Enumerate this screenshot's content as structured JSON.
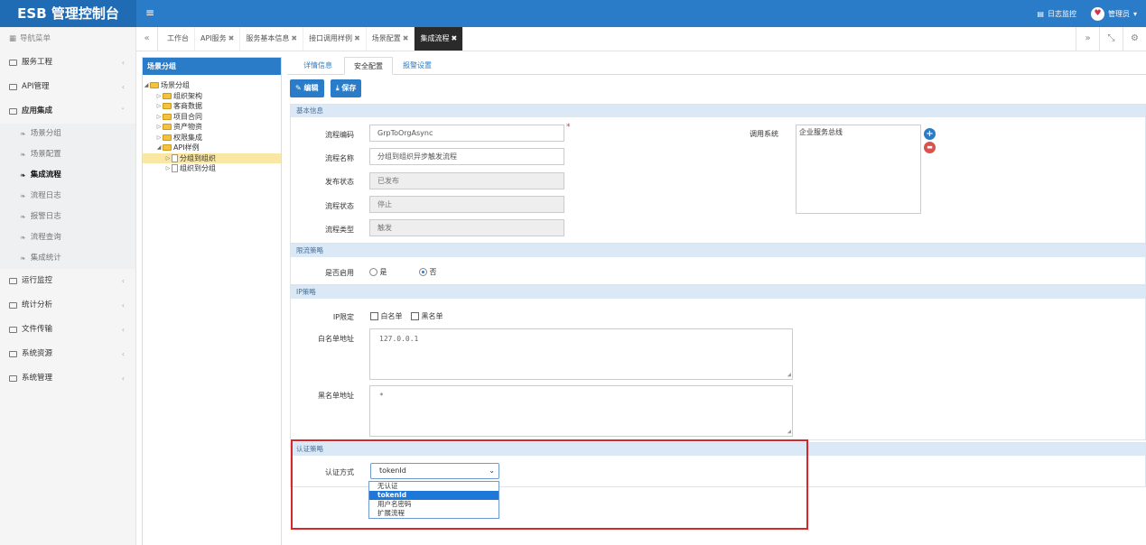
{
  "header": {
    "brand": "ESB 管理控制台",
    "menu_toggle_glyph": "≡",
    "log_monitor": "日志监控",
    "user": "管理员",
    "avatar_glyph": "♥",
    "colors": {
      "primary": "#2b7cc8",
      "brand_bg": "#1f6cb5",
      "highlight": "#d9262a"
    }
  },
  "sidebar": {
    "title": "导航菜单",
    "items": [
      {
        "label": "服务工程",
        "chevron": "‹"
      },
      {
        "label": "API管理",
        "chevron": "‹"
      },
      {
        "label": "应用集成",
        "chevron": "ˇ"
      }
    ],
    "subitems": [
      {
        "label": "场景分组"
      },
      {
        "label": "场景配置"
      },
      {
        "label": "集成流程"
      },
      {
        "label": "流程日志"
      },
      {
        "label": "报警日志"
      },
      {
        "label": "流程查询"
      },
      {
        "label": "集成统计"
      }
    ],
    "items_after": [
      {
        "label": "运行监控",
        "chevron": "‹"
      },
      {
        "label": "统计分析",
        "chevron": "‹"
      },
      {
        "label": "文件传输",
        "chevron": "‹"
      },
      {
        "label": "系统资源",
        "chevron": "‹"
      },
      {
        "label": "系统管理",
        "chevron": "‹"
      }
    ]
  },
  "tabbar": {
    "prev_glyph": "«",
    "next_glyph": "»",
    "fullscreen_glyph": "⤡",
    "settings_glyph": "⚙",
    "close_glyph": "✖",
    "tabs": [
      {
        "label": "工作台"
      },
      {
        "label": "API服务"
      },
      {
        "label": "服务基本信息"
      },
      {
        "label": "接口调用样例"
      },
      {
        "label": "场景配置"
      },
      {
        "label": "集成流程"
      }
    ]
  },
  "tree": {
    "title": "场景分组",
    "root": "场景分组",
    "nodes": [
      "组织架构",
      "客商数据",
      "项目合同",
      "资产物资",
      "权限集成",
      "API样例"
    ],
    "children": [
      "分组到组织",
      "组织到分组"
    ]
  },
  "main": {
    "subtabs": [
      "详情信息",
      "安全配置",
      "报警设置"
    ],
    "edit_button": "编辑",
    "save_button": "保存",
    "edit_icon": "✎",
    "save_icon": "⤓",
    "basic": {
      "title": "基本信息",
      "code_label": "流程编码",
      "code_value": "GrpToOrgAsync",
      "name_label": "流程名称",
      "name_value": "分组到组织异步触发流程",
      "publish_label": "发布状态",
      "publish_value": "已发布",
      "status_label": "流程状态",
      "status_value": "停止",
      "type_label": "流程类型",
      "type_value": "触发",
      "caller_label": "调用系统",
      "caller_value": "企业服务总线",
      "required_mark": "*",
      "add_glyph": "+",
      "delete_glyph": "▬"
    },
    "throttle": {
      "title": "限流策略",
      "enable_label": "是否启用",
      "opt_yes": "是",
      "opt_no": "否"
    },
    "ip": {
      "title": "IP策略",
      "limit_label": "IP限定",
      "whitelist": "白名单",
      "blacklist": "黑名单",
      "whitelist_addr_label": "白名单地址",
      "whitelist_addr_value": "127.0.0.1",
      "blacklist_addr_label": "黑名单地址",
      "blacklist_addr_value": "*"
    },
    "auth": {
      "title": "认证策略",
      "method_label": "认证方式",
      "selected": "tokenId",
      "caret": "⌄",
      "options": [
        "无认证",
        "tokenId",
        "用户名密码",
        "扩展流程"
      ]
    }
  }
}
